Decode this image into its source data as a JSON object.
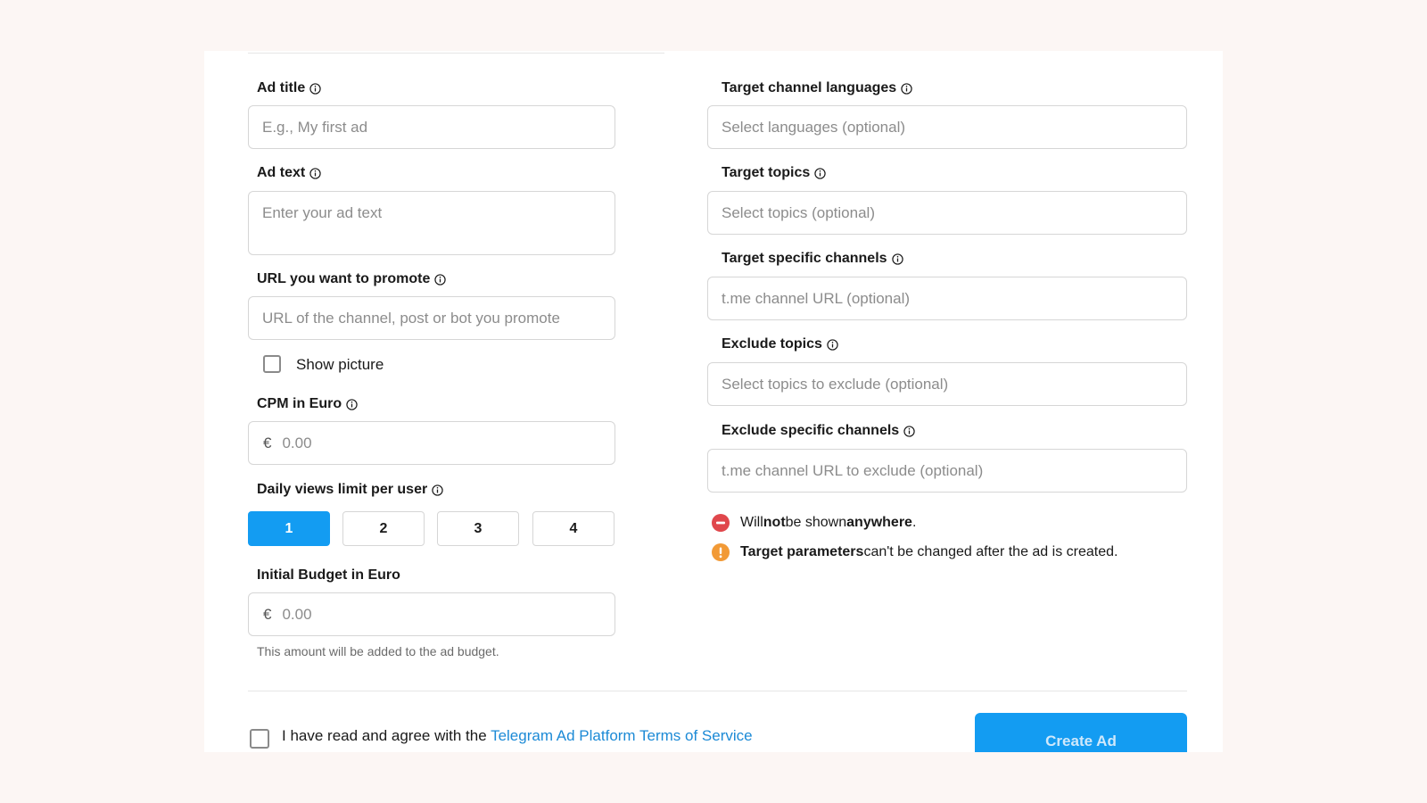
{
  "left": {
    "ad_title": {
      "label": "Ad title",
      "placeholder": "E.g., My first ad"
    },
    "ad_text": {
      "label": "Ad text",
      "placeholder": "Enter your ad text"
    },
    "url": {
      "label": "URL you want to promote",
      "placeholder": "URL of the channel, post or bot you promote"
    },
    "show_picture": {
      "label": "Show picture",
      "checked": false
    },
    "cpm": {
      "label": "CPM in Euro",
      "prefix": "€",
      "placeholder": "0.00"
    },
    "daily_views": {
      "label": "Daily views limit per user",
      "options": [
        "1",
        "2",
        "3",
        "4"
      ],
      "selected": "1"
    },
    "budget": {
      "label": "Initial Budget in Euro",
      "prefix": "€",
      "placeholder": "0.00",
      "hint": "This amount will be added to the ad budget."
    }
  },
  "right": {
    "languages": {
      "label": "Target channel languages",
      "placeholder": "Select languages (optional)"
    },
    "topics": {
      "label": "Target topics",
      "placeholder": "Select topics (optional)"
    },
    "channels": {
      "label": "Target specific channels",
      "placeholder": "t.me channel URL (optional)"
    },
    "exclude_topics": {
      "label": "Exclude topics",
      "placeholder": "Select topics to exclude (optional)"
    },
    "exclude_channels": {
      "label": "Exclude specific channels",
      "placeholder": "t.me channel URL to exclude (optional)"
    },
    "notice_1": {
      "part1": "Will ",
      "part2": "not",
      "part3": " be shown ",
      "part4": "anywhere",
      "part5": "."
    },
    "notice_2": {
      "part1": "Target parameters",
      "part2": " can't be changed after the ad is created."
    }
  },
  "footer": {
    "tos_prefix": "I have read and agree with the ",
    "tos_link": "Telegram Ad Platform Terms of Service",
    "create_label": "Create Ad"
  },
  "colors": {
    "accent": "#139cf2",
    "link": "#1c8ad6",
    "error": "#e0474c",
    "warning": "#f29a36"
  },
  "icons": {
    "info": "info-icon",
    "error": "minus-circle-icon",
    "warning": "exclamation-circle-icon"
  }
}
